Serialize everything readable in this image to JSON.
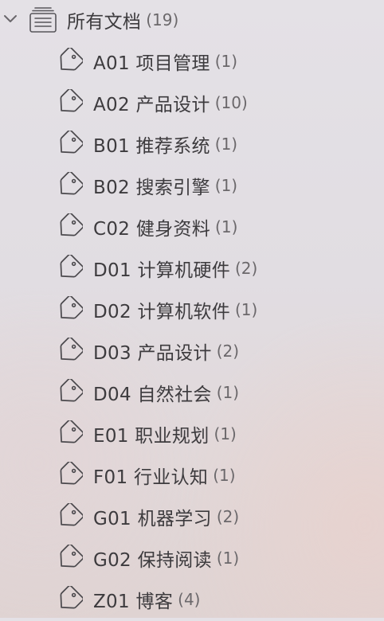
{
  "sidebar": {
    "root": {
      "label": "所有文档",
      "count": "(19)"
    },
    "tags": [
      {
        "label": "A01 项目管理",
        "count": "(1)"
      },
      {
        "label": "A02 产品设计",
        "count": "(10)"
      },
      {
        "label": "B01 推荐系统",
        "count": "(1)"
      },
      {
        "label": "B02 搜索引擎",
        "count": "(1)"
      },
      {
        "label": "C02 健身资料",
        "count": "(1)"
      },
      {
        "label": "D01 计算机硬件",
        "count": "(2)"
      },
      {
        "label": "D02 计算机软件",
        "count": "(1)"
      },
      {
        "label": "D03 产品设计",
        "count": "(2)"
      },
      {
        "label": "D04 自然社会",
        "count": "(1)"
      },
      {
        "label": "E01 职业规划",
        "count": "(1)"
      },
      {
        "label": "F01 行业认知",
        "count": "(1)"
      },
      {
        "label": "G01 机器学习",
        "count": "(2)"
      },
      {
        "label": "G02 保持阅读",
        "count": "(1)"
      },
      {
        "label": "Z01 博客",
        "count": "(4)"
      }
    ]
  },
  "icons": {
    "disclosure": "chevron-down-icon",
    "root": "documents-stack-icon",
    "tag": "tag-icon"
  }
}
